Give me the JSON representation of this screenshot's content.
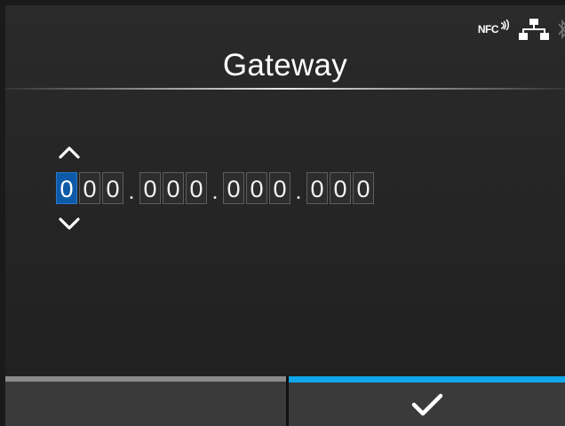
{
  "status": {
    "nfc_label": "NFC",
    "icons": [
      "nfc-icon",
      "wired-network-icon",
      "bluetooth-icon"
    ]
  },
  "title": "Gateway",
  "gateway": {
    "octets": [
      [
        "0",
        "0",
        "0"
      ],
      [
        "0",
        "0",
        "0"
      ],
      [
        "0",
        "0",
        "0"
      ],
      [
        "0",
        "0",
        "0"
      ]
    ],
    "separator": ".",
    "selected_digit": "octet-1-digit-1"
  },
  "footer": {
    "confirm_icon": "check-icon",
    "left_bar_color": "#8a8a8a",
    "right_bar_color": "#10a6ea"
  },
  "colors": {
    "selected_digit": "#0d5aa8",
    "background": "#262626"
  }
}
